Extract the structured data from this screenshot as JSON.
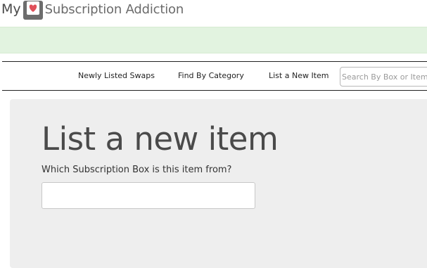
{
  "logo": {
    "prefix": "My",
    "name": "Subscription Addiction",
    "icon": "heart-box-icon",
    "colors": {
      "box": "#6d6d6d",
      "heart_bg": "#ffffff",
      "heart": "#e0505a"
    }
  },
  "banner": {
    "color": "#e2f3e0"
  },
  "nav": {
    "items": [
      {
        "label": "Newly Listed Swaps"
      },
      {
        "label": "Find By Category"
      },
      {
        "label": "List a New Item"
      }
    ],
    "search": {
      "placeholder": "Search By Box or Item Name",
      "value": ""
    }
  },
  "main": {
    "title": "List a new item",
    "box_field": {
      "label": "Which Subscription Box is this item from?",
      "value": ""
    }
  }
}
